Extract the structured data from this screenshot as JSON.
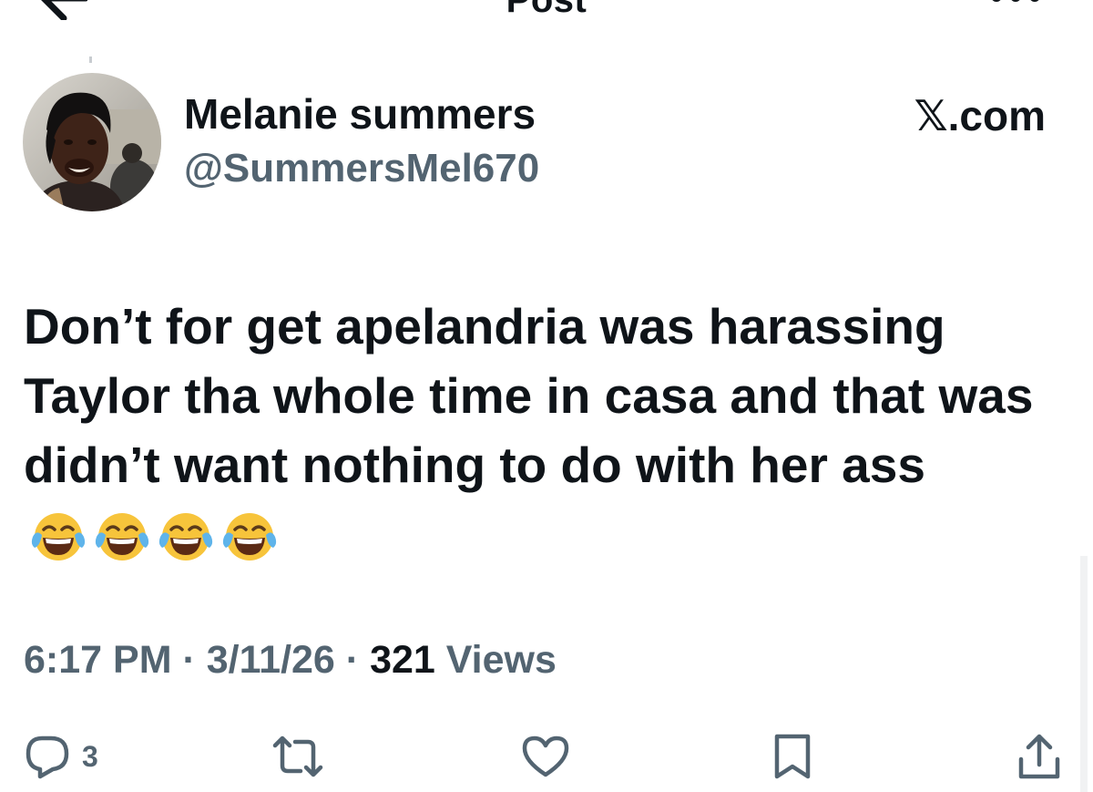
{
  "header": {
    "title": "Post",
    "back_icon": "arrow-left-icon",
    "more_icon": "more-horizontal-icon"
  },
  "author": {
    "display_name": "Melanie summers",
    "handle": "@SummersMel670",
    "avatar": "profile-photo"
  },
  "source_label": "𝕏.com",
  "post": {
    "text": "Don’t for get apelandria was harassing Taylor tha whole time in casa and that was didn’t want nothing to do with her ass",
    "emojis": [
      "😂",
      "😂",
      "😂",
      "😂"
    ]
  },
  "meta": {
    "time": "6:17 PM",
    "separator": "·",
    "date": "3/11/26",
    "views_count": "321",
    "views_label": "Views"
  },
  "actions": {
    "reply_count": "3",
    "icons": [
      "reply-icon",
      "repost-icon",
      "like-icon",
      "bookmark-icon",
      "share-icon"
    ]
  },
  "colors": {
    "text_primary": "#0f1419",
    "text_secondary": "#536471",
    "background": "#ffffff"
  }
}
